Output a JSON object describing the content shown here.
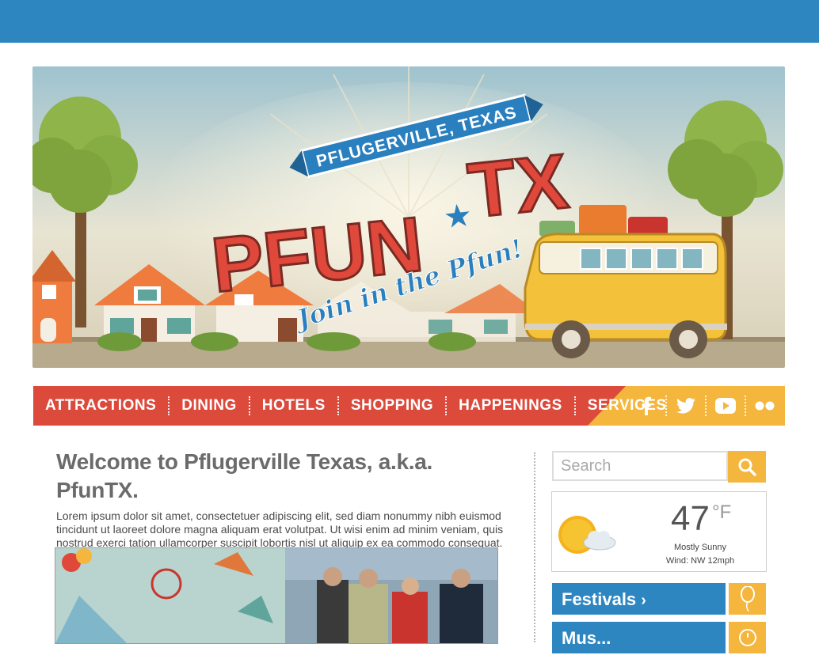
{
  "hero": {
    "ribbon_text": "PFLUGERVILLE, TEXAS",
    "logo_text_left": "PFUN",
    "logo_star": "★",
    "logo_text_right": "TX",
    "tagline": "Join in the Pfun!"
  },
  "nav": {
    "items": [
      "ATTRACTIONS",
      "DINING",
      "HOTELS",
      "SHOPPING",
      "HAPPENINGS",
      "SERVICES"
    ],
    "social": [
      "facebook-icon",
      "twitter-icon",
      "youtube-icon",
      "flickr-icon"
    ]
  },
  "main": {
    "title": "Welcome to Pflugerville Texas, a.k.a. PfunTX.",
    "intro": "Lorem ipsum dolor sit amet, consectetuer adipiscing elit, sed diam nonummy nibh euismod tincidunt ut laoreet dolore magna aliquam erat volutpat. Ut wisi enim ad minim veniam, quis nostrud exerci tation ullamcorper suscipit lobortis nisl ut aliquip ex ea commodo consequat. Duis autem vel eum iriure dolor in hendrerit in vulputate."
  },
  "search": {
    "placeholder": "Search"
  },
  "weather": {
    "temperature": "47",
    "unit": "°F",
    "condition": "Mostly Sunny",
    "wind": "Wind: NW 12mph"
  },
  "sidebar": {
    "festivals_label": "Festivals",
    "next_label": "Mus..."
  },
  "colors": {
    "blue": "#2e86c1",
    "red": "#dc4a3c",
    "yellow": "#f4b63d"
  }
}
